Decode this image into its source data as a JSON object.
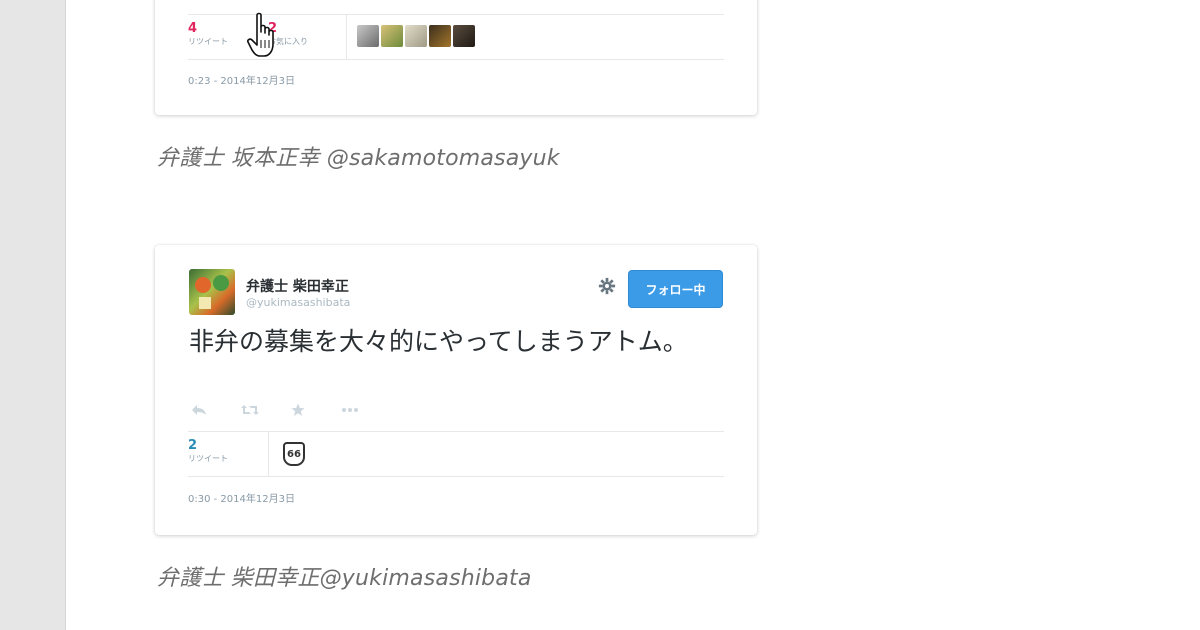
{
  "card1": {
    "retweets": {
      "count": "4",
      "label": "リツイート"
    },
    "favorites": {
      "count": "2",
      "label": "お気に入り"
    },
    "timestamp": "0:23 - 2014年12月3日"
  },
  "caption1": "弁護士 坂本正幸 @sakamotomasayuk",
  "card2": {
    "user": {
      "name": "弁護士 柴田幸正",
      "handle": "@yukimasashibata"
    },
    "follow_button": "フォロー中",
    "text": "非弁の募集を大々的にやってしまうアトム。",
    "retweets": {
      "count": "2",
      "label": "リツイート"
    },
    "badge": "66",
    "timestamp": "0:30 - 2014年12月3日"
  },
  "caption2": "弁護士 柴田幸正@yukimasashibata",
  "colors": {
    "follow_button": "#3b9be6",
    "retweet_red": "#e0245e",
    "retweet_teal": "#2a8eb4",
    "rail": "#e6e6e6"
  },
  "icons": [
    "reply-icon",
    "retweet-icon",
    "favorite-icon",
    "more-icon",
    "gear-icon",
    "hand-cursor-icon"
  ]
}
